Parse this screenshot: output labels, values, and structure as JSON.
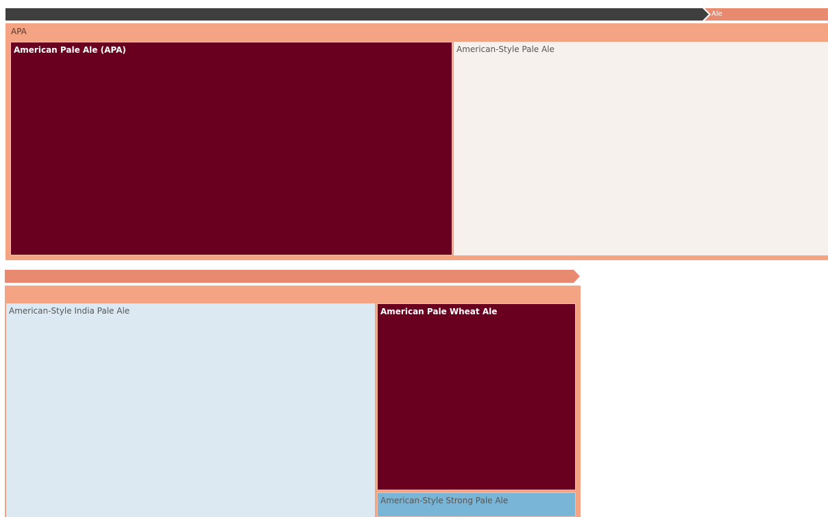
{
  "chart_data": {
    "type": "treemap",
    "breadcrumb": [
      "Ale"
    ],
    "groups": [
      {
        "name": "APA",
        "children": [
          {
            "name": "American Pale Ale (APA)",
            "color": "#690020"
          },
          {
            "name": "American-Style Pale Ale",
            "color": "#f6f1ed"
          }
        ]
      },
      {
        "name": "",
        "children": [
          {
            "name": "American-Style India Pale Ale",
            "color": "#dce9f2"
          },
          {
            "name": "American Pale Wheat Ale",
            "color": "#690020"
          },
          {
            "name": "American-Style Strong Pale Ale",
            "color": "#78b5d6"
          }
        ]
      }
    ]
  },
  "colors": {
    "path_bar_dark": "#3f3f3f",
    "path_bar_accent": "#e88a70",
    "group_fill": "#f4a383"
  }
}
